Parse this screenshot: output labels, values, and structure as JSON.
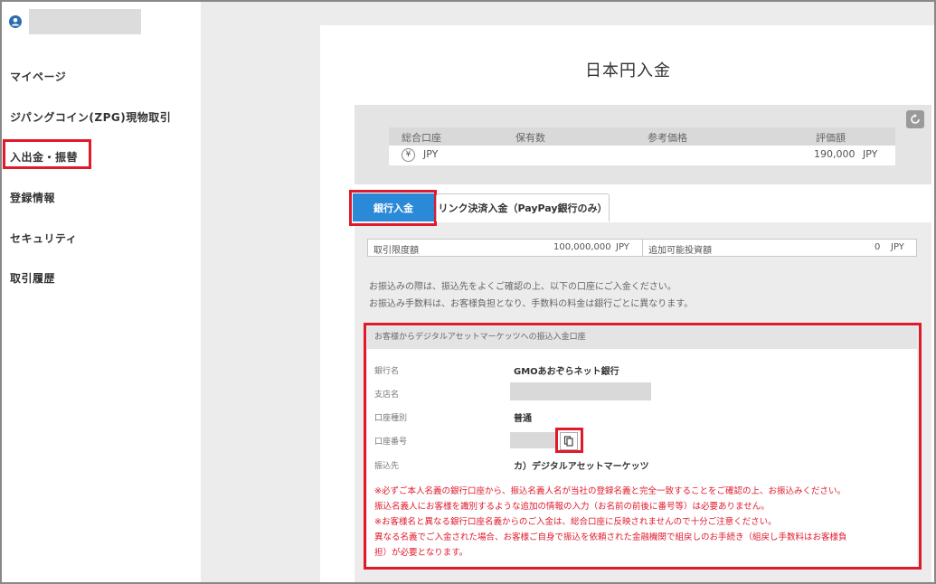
{
  "sidebar": {
    "items": [
      {
        "label": "マイページ"
      },
      {
        "label": "ジパングコイン(ZPG)現物取引"
      },
      {
        "label": "入出金・振替"
      },
      {
        "label": "登録情報"
      },
      {
        "label": "セキュリティ"
      },
      {
        "label": "取引履歴"
      }
    ]
  },
  "page": {
    "title": "日本円入金"
  },
  "summary": {
    "headers": [
      "総合口座",
      "保有数",
      "参考価格",
      "評価額"
    ],
    "currency_symbol": "¥",
    "currency": "JPY",
    "valuation": "190,000",
    "valuation_unit": "JPY"
  },
  "tabs": [
    {
      "label": "銀行入金",
      "active": true
    },
    {
      "label": "リンク決済入金（PayPay銀行のみ）",
      "active": false
    }
  ],
  "limits": {
    "limit_label": "取引限度額",
    "limit_value": "100,000,000",
    "limit_unit": "JPY",
    "available_label": "追加可能投資額",
    "available_value": "0",
    "available_unit": "JPY"
  },
  "info": {
    "line1": "お振込みの際は、振込先をよくご確認の上、以下の口座にご入金ください。",
    "line2": "お振込み手数料は、お客様負担となり、手数料の料金は銀行ごとに異なります。"
  },
  "account": {
    "heading": "お客様からデジタルアセットマーケッツへの振込入金口座",
    "bank_label": "銀行名",
    "bank_value": "GMOあおぞらネット銀行",
    "branch_label": "支店名",
    "type_label": "口座種別",
    "type_value": "普通",
    "number_label": "口座番号",
    "payee_label": "振込先",
    "payee_value": "カ）デジタルアセットマーケッツ"
  },
  "notices": [
    "※必ずご本人名義の銀行口座から、振込名義人名が当社の登録名義と完全一致することをご確認の上、お振込みください。",
    "振込名義人にお客様を識別するような追加の情報の入力（お名前の前後に番号等）は必要ありません。",
    "※お客様名と異なる銀行口座名義からのご入金は、総合口座に反映されませんので十分ご注意ください。",
    "異なる名義でご入金された場合、お客様ご自身で振込を依頼された金融機関で組戻しのお手続き（組戻し手数料はお客様負",
    "担）が必要となります。"
  ],
  "colors": {
    "accent": "#2b8ad8",
    "highlight": "#e0192b",
    "notice": "#e0192b"
  }
}
